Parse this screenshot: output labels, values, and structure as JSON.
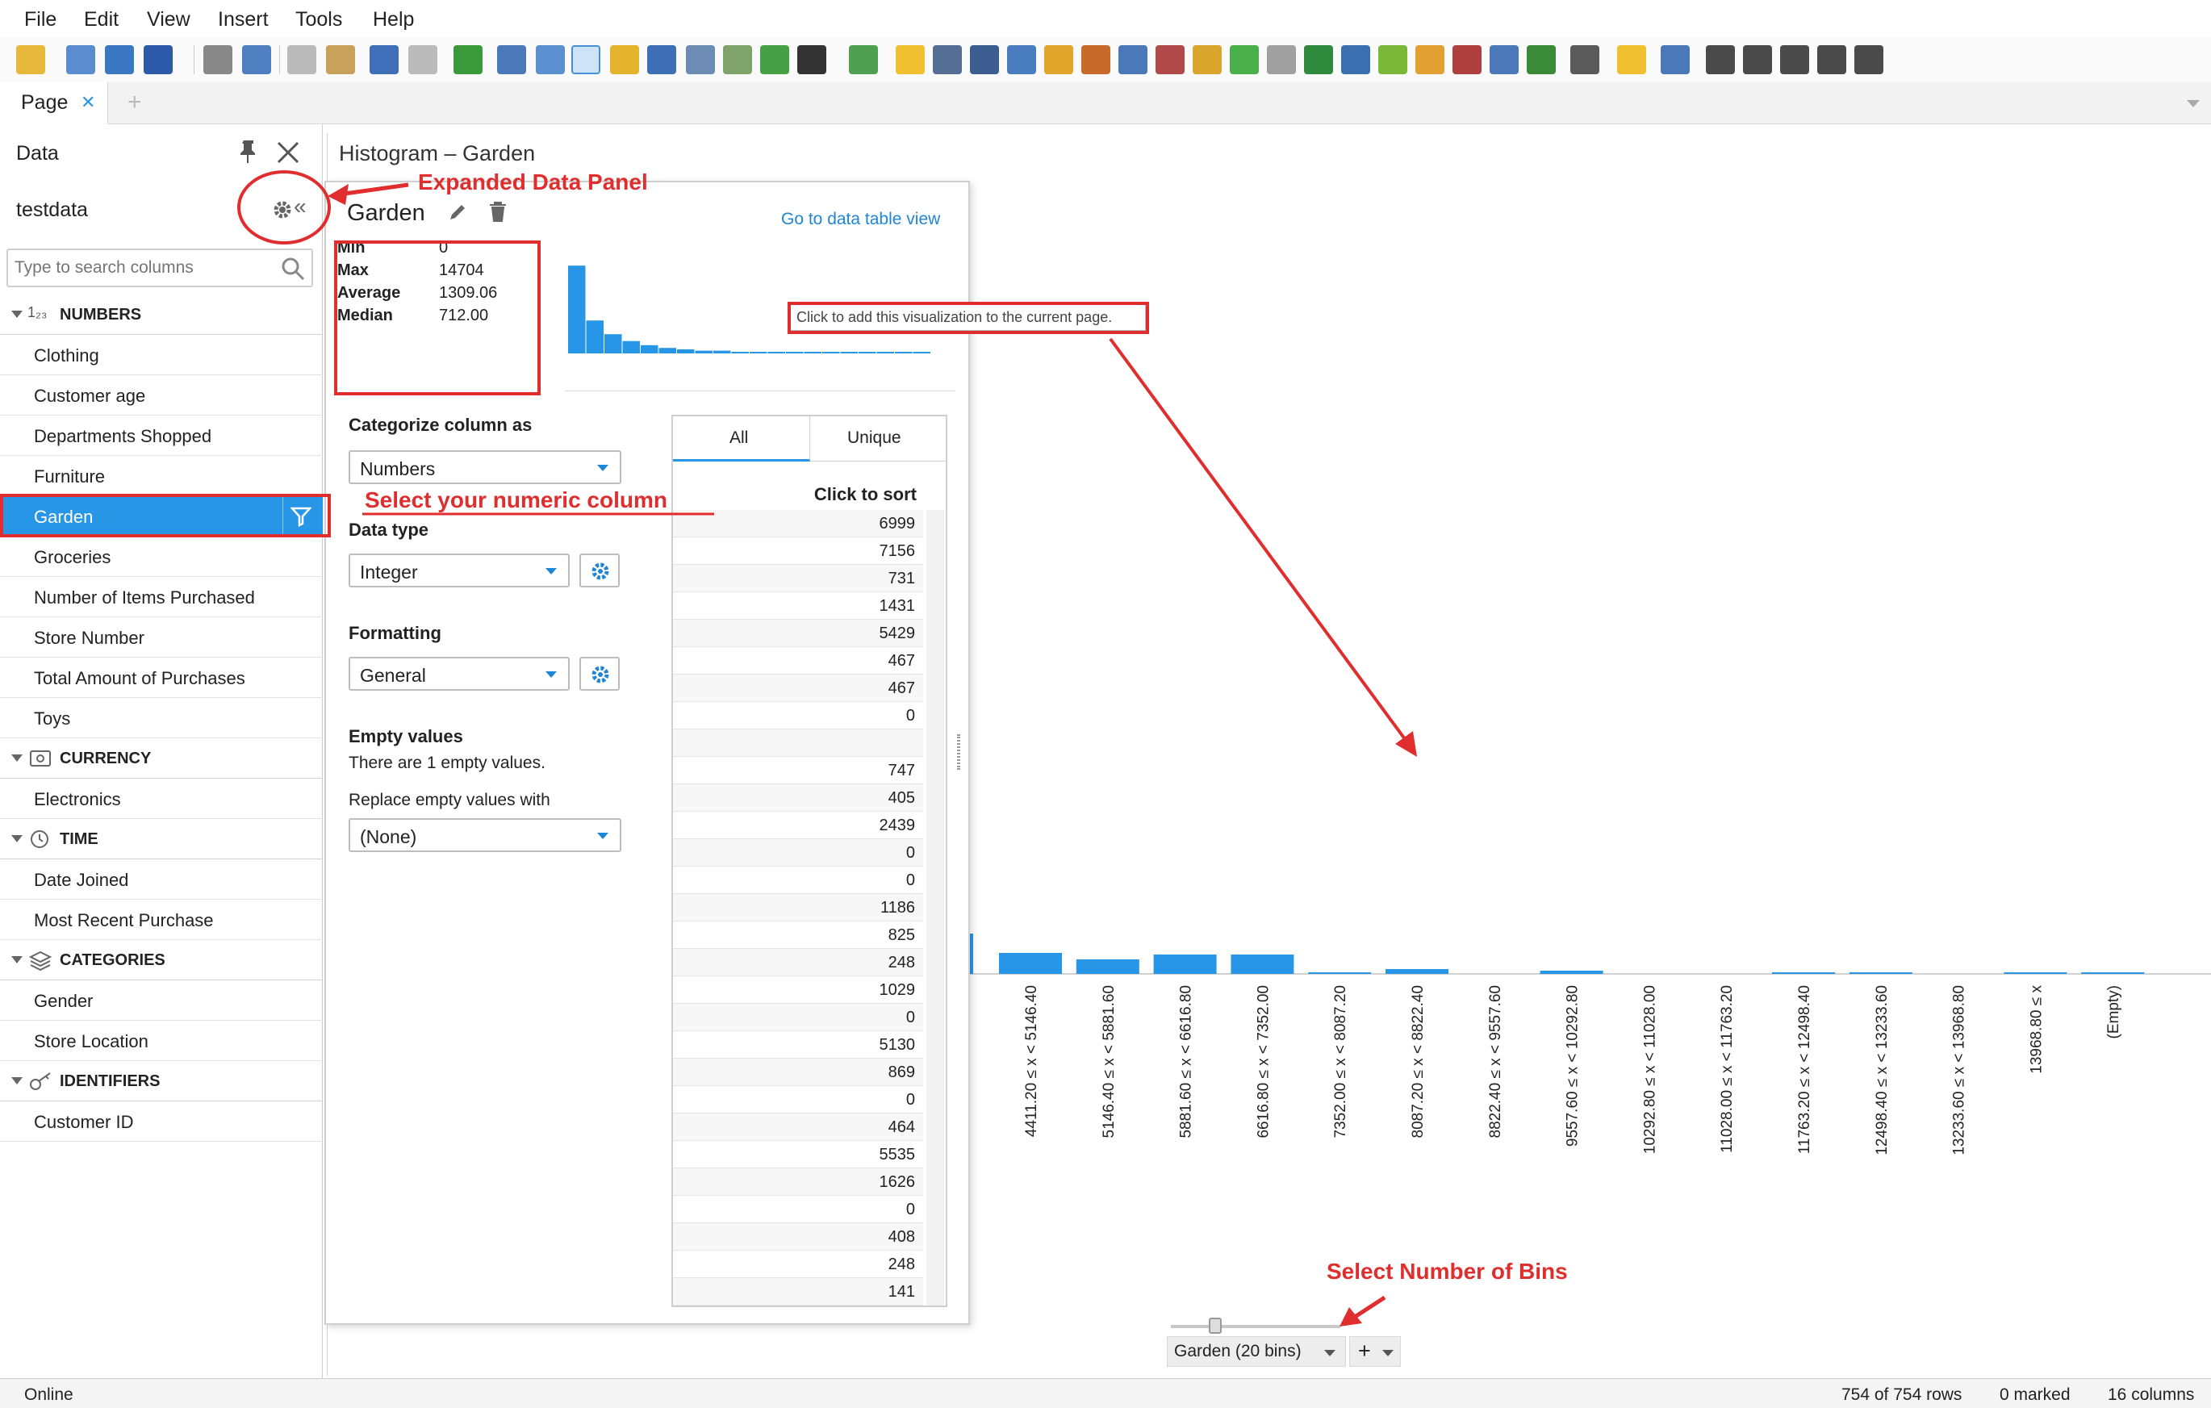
{
  "menu": [
    "File",
    "Edit",
    "View",
    "Insert",
    "Tools",
    "Help"
  ],
  "tabs": {
    "page_label": "Page",
    "close_glyph": "✕",
    "add_glyph": "+"
  },
  "data_panel": {
    "title": "Data",
    "source": "testdata",
    "search_placeholder": "Type to search columns",
    "categories": [
      {
        "label": "NUMBERS",
        "prefix": "1₂₃",
        "items": [
          "Clothing",
          "Customer age",
          "Departments Shopped",
          "Furniture",
          "Garden",
          "Groceries",
          "Number of Items Purchased",
          "Store Number",
          "Total Amount of Purchases",
          "Toys"
        ]
      },
      {
        "label": "CURRENCY",
        "items": [
          "Electronics"
        ]
      },
      {
        "label": "TIME",
        "items": [
          "Date Joined",
          "Most Recent Purchase"
        ]
      },
      {
        "label": "CATEGORIES",
        "items": [
          "Gender",
          "Store Location"
        ]
      },
      {
        "label": "IDENTIFIERS",
        "items": [
          "Customer ID"
        ]
      }
    ],
    "selected_item": "Garden"
  },
  "viz": {
    "title": "Histogram – Garden",
    "bins_label": "Garden (20 bins)",
    "add_glyph": "+"
  },
  "detail": {
    "column_name": "Garden",
    "link_label": "Go to data table view",
    "stats": [
      {
        "label": "Min",
        "value": "0"
      },
      {
        "label": "Max",
        "value": "14704"
      },
      {
        "label": "Average",
        "value": "1309.06"
      },
      {
        "label": "Median",
        "value": "712.00"
      }
    ],
    "tooltip": "Click to add this visualization to the current page.",
    "categorize_label": "Categorize column as",
    "categorize_value": "Numbers",
    "datatype_label": "Data type",
    "datatype_value": "Integer",
    "formatting_label": "Formatting",
    "formatting_value": "General",
    "empty_label": "Empty values",
    "empty_note": "There are 1 empty values.",
    "replace_label": "Replace empty values with",
    "replace_value": "(None)",
    "tab_all": "All",
    "tab_unique": "Unique",
    "sort_label": "Click to sort",
    "values": [
      "6999",
      "7156",
      "731",
      "1431",
      "5429",
      "467",
      "467",
      "0",
      "",
      "747",
      "405",
      "2439",
      "0",
      "0",
      "1186",
      "825",
      "248",
      "1029",
      "0",
      "5130",
      "869",
      "0",
      "464",
      "5535",
      "1626",
      "0",
      "408",
      "248",
      "141"
    ]
  },
  "chart_data": {
    "type": "bar",
    "title": "Histogram – Garden",
    "categories": [
      "4411.20 ≤ x < 5146.40",
      "5146.40 ≤ x < 5881.60",
      "5881.60 ≤ x < 6616.80",
      "6616.80 ≤ x < 7352.00",
      "7352.00 ≤ x < 8087.20",
      "8087.20 ≤ x < 8822.40",
      "8822.40 ≤ x < 9557.60",
      "9557.60 ≤ x < 10292.80",
      "10292.80 ≤ x < 11028.00",
      "11028.00 ≤ x < 11763.20",
      "11763.20 ≤ x < 12498.40",
      "12498.40 ≤ x < 13233.60",
      "13233.60 ≤ x < 13968.80",
      "13968.80 ≤ x",
      "(Empty)"
    ],
    "values": [
      13,
      9,
      12,
      12,
      1,
      3,
      0,
      2,
      0,
      0,
      1,
      1,
      0,
      1,
      1
    ],
    "mini_histogram": [
      64,
      24,
      14,
      9,
      6,
      4,
      3,
      2,
      2,
      1,
      1,
      1,
      0,
      0,
      0,
      0,
      0,
      1,
      0,
      1
    ]
  },
  "annotations": {
    "expanded": "Expanded Data Panel",
    "select_column": "Select your numeric column",
    "select_bins": "Select Number of Bins"
  },
  "status": {
    "online": "Online",
    "rows": "754 of 754 rows",
    "marked": "0 marked",
    "columns": "16 columns"
  },
  "colors": {
    "accent": "#2896e6",
    "selected": "#2896e6",
    "annotation": "#e02d2d"
  }
}
